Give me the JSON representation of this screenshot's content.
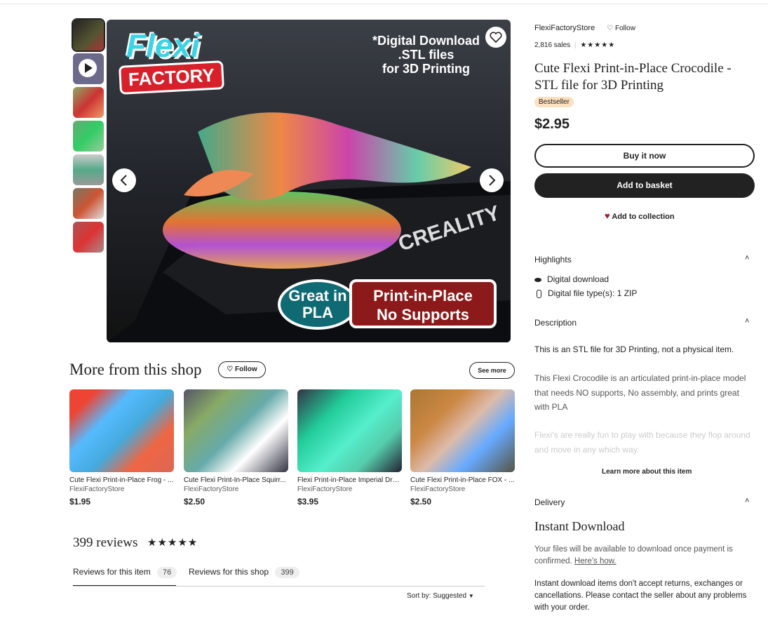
{
  "gallery": {
    "thumbs": [
      "thumb-1",
      "thumb-video",
      "thumb-3",
      "thumb-4",
      "thumb-5",
      "thumb-6",
      "thumb-7"
    ],
    "main_image": {
      "logo_top": "Flexi",
      "logo_bottom": "FACTORY",
      "badge_line1": "*Digital Download",
      "badge_line2": ".STL files",
      "badge_line3": "for 3D Printing",
      "pla_line1": "Great in",
      "pla_line2": "PLA",
      "pip_line1": "Print-in-Place",
      "pip_line2": "No Supports",
      "bed_brand": "CREALITY"
    }
  },
  "shop": {
    "name": "FlexiFactoryStore",
    "follow": "Follow",
    "sales": "2,816 sales",
    "stars": "★★★★★"
  },
  "listing": {
    "title": "Cute Flexi Print-in-Place Crocodile - STL file for 3D Printing",
    "badge": "Bestseller",
    "price": "$2.95",
    "buy_now": "Buy it now",
    "add_basket": "Add to basket",
    "add_collection": "Add to collection"
  },
  "highlights": {
    "heading": "Highlights",
    "items": [
      "Digital download",
      "Digital file type(s): 1 ZIP"
    ]
  },
  "description": {
    "heading": "Description",
    "p1": "This is an STL file for 3D Printing, not a physical item.",
    "p2": "This Flexi Crocodile is an articulated print-in-place model that needs NO supports, No assembly, and prints great with PLA",
    "p3": "Flexi's are really fun to play with because they flop around and move in any which way.",
    "learn_more": "Learn more about this item"
  },
  "delivery": {
    "heading": "Delivery",
    "title": "Instant Download",
    "p1": "Your files will be available to download once payment is confirmed.",
    "link": "Here's how.",
    "p2": "Instant download items don't accept returns, exchanges or cancellations. Please contact the seller about any problems with your order."
  },
  "more": {
    "heading": "More from this shop",
    "follow": "Follow",
    "see_more": "See more",
    "cards": [
      {
        "title": "Cute Flexi Print-in-Place Frog - ...",
        "shop": "FlexiFactoryStore",
        "price": "$1.95"
      },
      {
        "title": "Cute Flexi Print-In-Place Squirr...",
        "shop": "FlexiFactoryStore",
        "price": "$2.50"
      },
      {
        "title": "Flexi Print-in-Place Imperial Dra...",
        "shop": "FlexiFactoryStore",
        "price": "$3.95"
      },
      {
        "title": "Cute Flexi Print-in-Place FOX - ...",
        "shop": "FlexiFactoryStore",
        "price": "$2.50"
      }
    ]
  },
  "reviews": {
    "count": "399 reviews",
    "stars": "★★★★★",
    "tab_item": "Reviews for this item",
    "tab_item_count": "76",
    "tab_shop": "Reviews for this shop",
    "tab_shop_count": "399",
    "sort": "Sort by: Suggested"
  },
  "colors": {
    "accent_dark": "#222222",
    "bestseller_bg": "#fde0c0",
    "heart": "#a61a2e"
  }
}
